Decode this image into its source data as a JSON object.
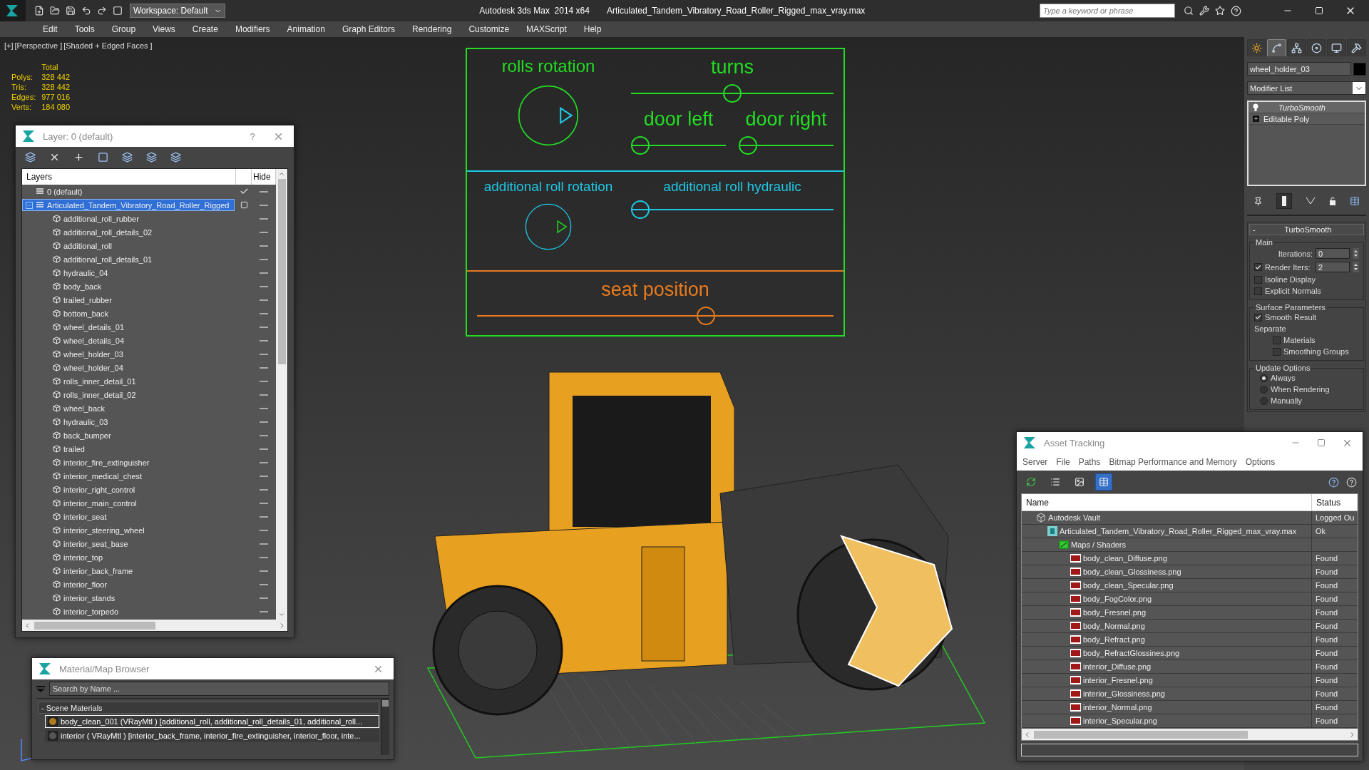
{
  "title_bar": {
    "workspace": "Workspace: Default",
    "app_title": "Autodesk 3ds Max  2014 x64",
    "file_name": "Articulated_Tandem_Vibratory_Road_Roller_Rigged_max_vray.max",
    "search": {
      "placeholder": "Type a keyword or phrase"
    }
  },
  "menu_bar": [
    "Edit",
    "Tools",
    "Group",
    "Views",
    "Create",
    "Modifiers",
    "Animation",
    "Graph Editors",
    "Rendering",
    "Customize",
    "MAXScript",
    "Help"
  ],
  "viewport": {
    "labels": [
      "[+]",
      "[Perspective ]",
      "[Shaded + Edged Faces ]"
    ],
    "stats": {
      "header": "Total",
      "rows": [
        {
          "label": "Polys:",
          "value": "328 442"
        },
        {
          "label": "Tris:",
          "value": "328 442"
        },
        {
          "label": "Edges:",
          "value": "977 016"
        },
        {
          "label": "Verts:",
          "value": "184 080"
        }
      ]
    },
    "rig_panel": {
      "sections": [
        {
          "color": "#22dd22",
          "controls": [
            {
              "kind": "dial",
              "label": "rolls rotation"
            },
            {
              "kind": "slider",
              "label": "turns",
              "level": 0.5
            },
            {
              "kind": "slider",
              "label": "door left",
              "level": 0
            },
            {
              "kind": "slider",
              "label": "door right",
              "level": 0
            }
          ]
        },
        {
          "color": "#1ec8e6",
          "controls": [
            {
              "kind": "dial",
              "label": "additional roll rotation"
            },
            {
              "kind": "slider",
              "label": "additional roll hydraulic",
              "level": 0
            }
          ]
        },
        {
          "color": "#e87a1e",
          "controls": [
            {
              "kind": "slider",
              "label": "seat position",
              "level": 0.65
            }
          ]
        }
      ]
    }
  },
  "layer_window": {
    "title": "Layer: 0 (default)",
    "help": "?",
    "columns": [
      "Layers",
      "Hide"
    ],
    "layers": [
      {
        "name": "0 (default)",
        "current": true,
        "selected": false
      },
      {
        "name": "Articulated_Tandem_Vibratory_Road_Roller_Rigged",
        "current": false,
        "selected": true,
        "expanded": true,
        "children": [
          {
            "name": "additional_roll_rubber",
            "selected": false
          },
          {
            "name": "additional_roll_details_02",
            "selected": false
          },
          {
            "name": "additional_roll",
            "selected": false
          },
          {
            "name": "additional_roll_details_01",
            "selected": false
          },
          {
            "name": "hydraulic_04",
            "selected": false
          },
          {
            "name": "body_back",
            "selected": false
          },
          {
            "name": "trailed_rubber",
            "selected": false
          },
          {
            "name": "bottom_back",
            "selected": false
          },
          {
            "name": "wheel_details_01",
            "selected": false
          },
          {
            "name": "wheel_details_04",
            "selected": false
          },
          {
            "name": "wheel_holder_03",
            "selected": false
          },
          {
            "name": "wheel_holder_04",
            "selected": false
          },
          {
            "name": "rolls_inner_detail_01",
            "selected": false
          },
          {
            "name": "rolls_inner_detail_02",
            "selected": false
          },
          {
            "name": "wheel_back",
            "selected": false
          },
          {
            "name": "hydraulic_03",
            "selected": false
          },
          {
            "name": "back_bumper",
            "selected": false
          },
          {
            "name": "trailed",
            "selected": false
          },
          {
            "name": "interior_fire_extinguisher",
            "selected": false
          },
          {
            "name": "interior_medical_chest",
            "selected": false
          },
          {
            "name": "interior_right_control",
            "selected": false
          },
          {
            "name": "interior_main_control",
            "selected": false
          },
          {
            "name": "interior_seat",
            "selected": false
          },
          {
            "name": "interior_steering_wheel",
            "selected": false
          },
          {
            "name": "interior_seat_base",
            "selected": false
          },
          {
            "name": "interior_top",
            "selected": false
          },
          {
            "name": "interior_back_frame",
            "selected": false
          },
          {
            "name": "interior_floor",
            "selected": false
          },
          {
            "name": "interior_stands",
            "selected": false
          },
          {
            "name": "interior_torpedo",
            "selected": false
          }
        ]
      }
    ]
  },
  "material_browser": {
    "title": "Material/Map Browser",
    "search": {
      "placeholder": "Search by Name ..."
    },
    "groups": [
      {
        "toggle": "-",
        "label": "Scene Materials",
        "items": [
          {
            "label": "body_clean_001 (VRayMtl ) [additional_roll, additional_roll_details_01, additional_roll...",
            "selected": true
          },
          {
            "label": "interior ( VRayMtl ) [interior_back_frame, interior_fire_extinguisher, interior_floor, inte...",
            "selected": false
          }
        ]
      }
    ]
  },
  "asset_tracking": {
    "title": "Asset Tracking",
    "menu": [
      "Server",
      "File",
      "Paths",
      "Bitmap Performance and Memory",
      "Options"
    ],
    "toolbar": [
      {
        "selected": false
      },
      {
        "selected": false
      },
      {
        "selected": false
      },
      {
        "selected": true
      }
    ],
    "columns": [
      "Name",
      "Status"
    ],
    "rows": [
      {
        "kind": "server",
        "name": "Autodesk Vault",
        "status": "Logged Ou",
        "children": [
          {
            "kind": "scene_file",
            "name": "Articulated_Tandem_Vibratory_Road_Roller_Rigged_max_vray.max",
            "status": "Ok",
            "children": [
              {
                "kind": "folder",
                "name": "Maps / Shaders",
                "children": [
                  {
                    "kind": "png",
                    "name": "body_clean_Diffuse.png",
                    "status": "Found"
                  },
                  {
                    "kind": "png",
                    "name": "body_clean_Glossiness.png",
                    "status": "Found"
                  },
                  {
                    "kind": "png",
                    "name": "body_clean_Specular.png",
                    "status": "Found"
                  },
                  {
                    "kind": "png",
                    "name": "body_FogColor.png",
                    "status": "Found"
                  },
                  {
                    "kind": "png",
                    "name": "body_Fresnel.png",
                    "status": "Found"
                  },
                  {
                    "kind": "png",
                    "name": "body_Normal.png",
                    "status": "Found"
                  },
                  {
                    "kind": "png",
                    "name": "body_Refract.png",
                    "status": "Found"
                  },
                  {
                    "kind": "png",
                    "name": "body_RefractGlossines.png",
                    "status": "Found"
                  },
                  {
                    "kind": "png",
                    "name": "interior_Diffuse.png",
                    "status": "Found"
                  },
                  {
                    "kind": "png",
                    "name": "interior_Fresnel.png",
                    "status": "Found"
                  },
                  {
                    "kind": "png",
                    "name": "interior_Glossiness.png",
                    "status": "Found"
                  },
                  {
                    "kind": "png",
                    "name": "interior_Normal.png",
                    "status": "Found"
                  },
                  {
                    "kind": "png",
                    "name": "interior_Specular.png",
                    "status": "Found"
                  }
                ]
              }
            ]
          }
        ]
      }
    ]
  },
  "command_panel": {
    "tabs": [
      {
        "selected": false
      },
      {
        "selected": true
      },
      {
        "selected": false
      },
      {
        "selected": false
      },
      {
        "selected": false
      },
      {
        "selected": false
      }
    ],
    "object_name": "wheel_holder_03",
    "modifier_list": "Modifier List",
    "stack": [
      {
        "kind": "modifier",
        "label": "TurboSmooth"
      },
      {
        "kind": "base_object",
        "label": "Editable Poly",
        "expanded": false
      }
    ],
    "rollout": {
      "toggle": "-",
      "title": "TurboSmooth",
      "groups": [
        {
          "title": "Main",
          "items": [
            {
              "kind": "spinner",
              "label": "Iterations:",
              "value": "0"
            },
            {
              "kind": "check_spinner",
              "label": "Render Iters:",
              "checked": true,
              "value": "2"
            },
            {
              "kind": "checkbox",
              "label": "Isoline Display",
              "checked": false
            },
            {
              "kind": "checkbox",
              "label": "Explicit Normals",
              "checked": false
            }
          ]
        },
        {
          "title": "Surface Parameters",
          "items": [
            {
              "kind": "checkbox",
              "label": "Smooth Result",
              "checked": true
            },
            {
              "kind": "subheading",
              "label": "Separate",
              "children": [
                {
                  "kind": "checkbox",
                  "label": "Materials",
                  "checked": false
                },
                {
                  "kind": "checkbox",
                  "label": "Smoothing Groups",
                  "checked": false
                }
              ]
            }
          ]
        },
        {
          "title": "Update Options",
          "items": [
            {
              "kind": "radio",
              "label": "Always",
              "selected": true
            },
            {
              "kind": "radio",
              "label": "When Rendering",
              "selected": false
            },
            {
              "kind": "radio",
              "label": "Manually",
              "selected": false
            }
          ]
        }
      ]
    }
  }
}
